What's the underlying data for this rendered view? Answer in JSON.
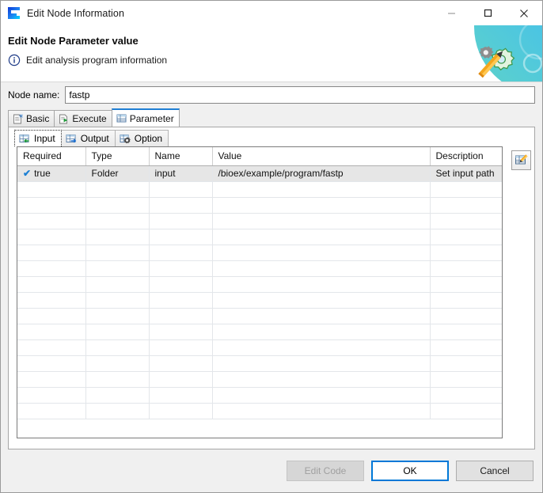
{
  "window": {
    "title": "Edit Node Information",
    "logo_icon": "app-logo-icon",
    "controls": {
      "minimize": "minimize-icon",
      "maximize": "maximize-icon",
      "close": "close-icon"
    }
  },
  "header": {
    "title": "Edit Node Parameter value",
    "subtitle": "Edit analysis program information",
    "info_icon": "info-icon",
    "art_icon": "gears-pencil-icon",
    "accent_blue": "#29abe2",
    "accent_teal": "#5fd3c8"
  },
  "node_name": {
    "label": "Node name:",
    "value": "fastp",
    "placeholder": ""
  },
  "outer_tabs": [
    {
      "label": "Basic",
      "icon": "document-star-icon",
      "selected": false
    },
    {
      "label": "Execute",
      "icon": "document-play-icon",
      "selected": false
    },
    {
      "label": "Parameter",
      "icon": "table-icon",
      "selected": true
    }
  ],
  "inner_tabs": [
    {
      "label": "Input",
      "icon": "table-in-icon",
      "selected": true
    },
    {
      "label": "Output",
      "icon": "table-out-icon",
      "selected": false
    },
    {
      "label": "Option",
      "icon": "table-gear-icon",
      "selected": false
    }
  ],
  "table": {
    "columns": [
      "Required",
      "Type",
      "Name",
      "Value",
      "Description"
    ],
    "rows": [
      {
        "selected": true,
        "required_check": "✔",
        "cells": [
          "true",
          "Folder",
          "input",
          "/bioex/example/program/fastp",
          "Set input path"
        ]
      }
    ],
    "empty_row_count": 15
  },
  "side_buttons": [
    {
      "name": "edit-table-button",
      "icon": "table-pencil-icon"
    }
  ],
  "footer": {
    "edit_code": {
      "label": "Edit Code",
      "disabled": true
    },
    "ok": {
      "label": "OK",
      "default": true
    },
    "cancel": {
      "label": "Cancel",
      "disabled": false
    }
  }
}
